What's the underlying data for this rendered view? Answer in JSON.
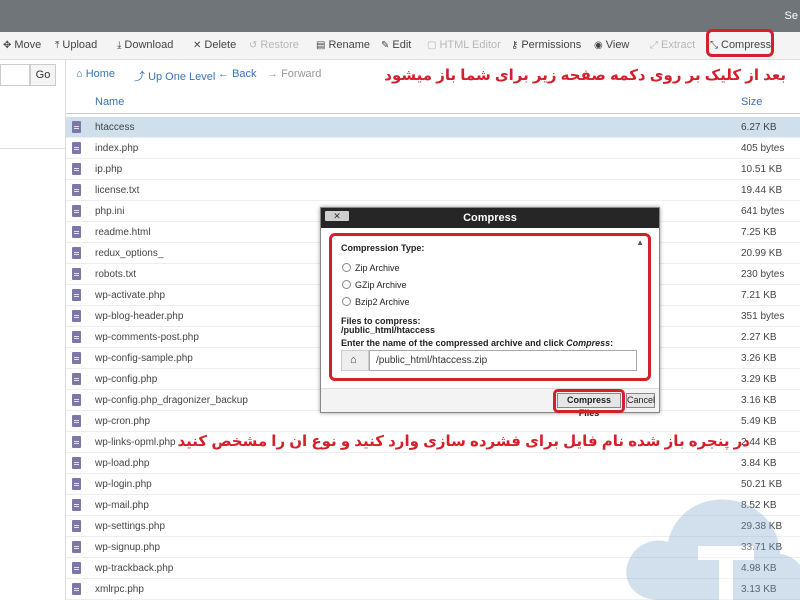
{
  "topbar": {
    "right_text": "Se"
  },
  "toolbar": {
    "move": "Move",
    "upload": "Upload",
    "download": "Download",
    "delete": "Delete",
    "restore": "Restore",
    "rename": "Rename",
    "edit": "Edit",
    "html_editor": "HTML Editor",
    "permissions": "Permissions",
    "view": "View",
    "extract": "Extract",
    "compress": "Compress"
  },
  "leftpane": {
    "go_label": "Go"
  },
  "nav": {
    "home": "Home",
    "up_one_level": "Up One Level",
    "back": "Back",
    "forward": "Forward"
  },
  "table": {
    "col_name": "Name",
    "col_size": "Size",
    "rows": [
      {
        "name": "htaccess",
        "size": "6.27 KB"
      },
      {
        "name": "index.php",
        "size": "405 bytes"
      },
      {
        "name": "ip.php",
        "size": "10.51 KB"
      },
      {
        "name": "license.txt",
        "size": "19.44 KB"
      },
      {
        "name": "php.ini",
        "size": "641 bytes"
      },
      {
        "name": "readme.html",
        "size": "7.25 KB"
      },
      {
        "name": "redux_options_",
        "size": "20.99 KB"
      },
      {
        "name": "robots.txt",
        "size": "230 bytes"
      },
      {
        "name": "wp-activate.php",
        "size": "7.21 KB"
      },
      {
        "name": "wp-blog-header.php",
        "size": "351 bytes"
      },
      {
        "name": "wp-comments-post.php",
        "size": "2.27 KB"
      },
      {
        "name": "wp-config-sample.php",
        "size": "3.26 KB"
      },
      {
        "name": "wp-config.php",
        "size": "3.29 KB"
      },
      {
        "name": "wp-config.php_dragonizer_backup",
        "size": "3.16 KB"
      },
      {
        "name": "wp-cron.php",
        "size": "5.49 KB"
      },
      {
        "name": "wp-links-opml.php",
        "size": "2.44 KB"
      },
      {
        "name": "wp-load.php",
        "size": "3.84 KB"
      },
      {
        "name": "wp-login.php",
        "size": "50.21 KB"
      },
      {
        "name": "wp-mail.php",
        "size": "8.52 KB"
      },
      {
        "name": "wp-settings.php",
        "size": "29.38 KB"
      },
      {
        "name": "wp-signup.php",
        "size": "33.71 KB"
      },
      {
        "name": "wp-trackback.php",
        "size": "4.98 KB"
      },
      {
        "name": "xmlrpc.php",
        "size": "3.13 KB"
      }
    ]
  },
  "notes": {
    "top": "بعد از کلیک بر روی دکمه صفحه زیر برای شما باز میشود",
    "bottom": "در پنجره باز شده نام فایل برای فشرده سازی وارد کنید و نوع ان را مشخص کنید"
  },
  "modal": {
    "title": "Compress",
    "close": "✕",
    "compression_type_label": "Compression Type:",
    "options": [
      "Zip Archive",
      "GZip Archive",
      "Bzip2 Archive"
    ],
    "files_label": "Files to compress:",
    "files_value": "/public_html/htaccess",
    "instruction_prefix": "Enter the name of the compressed archive and click ",
    "instruction_emph": "Compress",
    "instruction_suffix": ":",
    "archive_path": "/public_html/htaccess.zip",
    "compress_button": "Compress Files",
    "cancel_button": "Cancel"
  },
  "colors": {
    "accent": "#d3202a",
    "link": "#3a73b5",
    "selected_row": "#cfdfeb",
    "modal_header": "#262626"
  }
}
